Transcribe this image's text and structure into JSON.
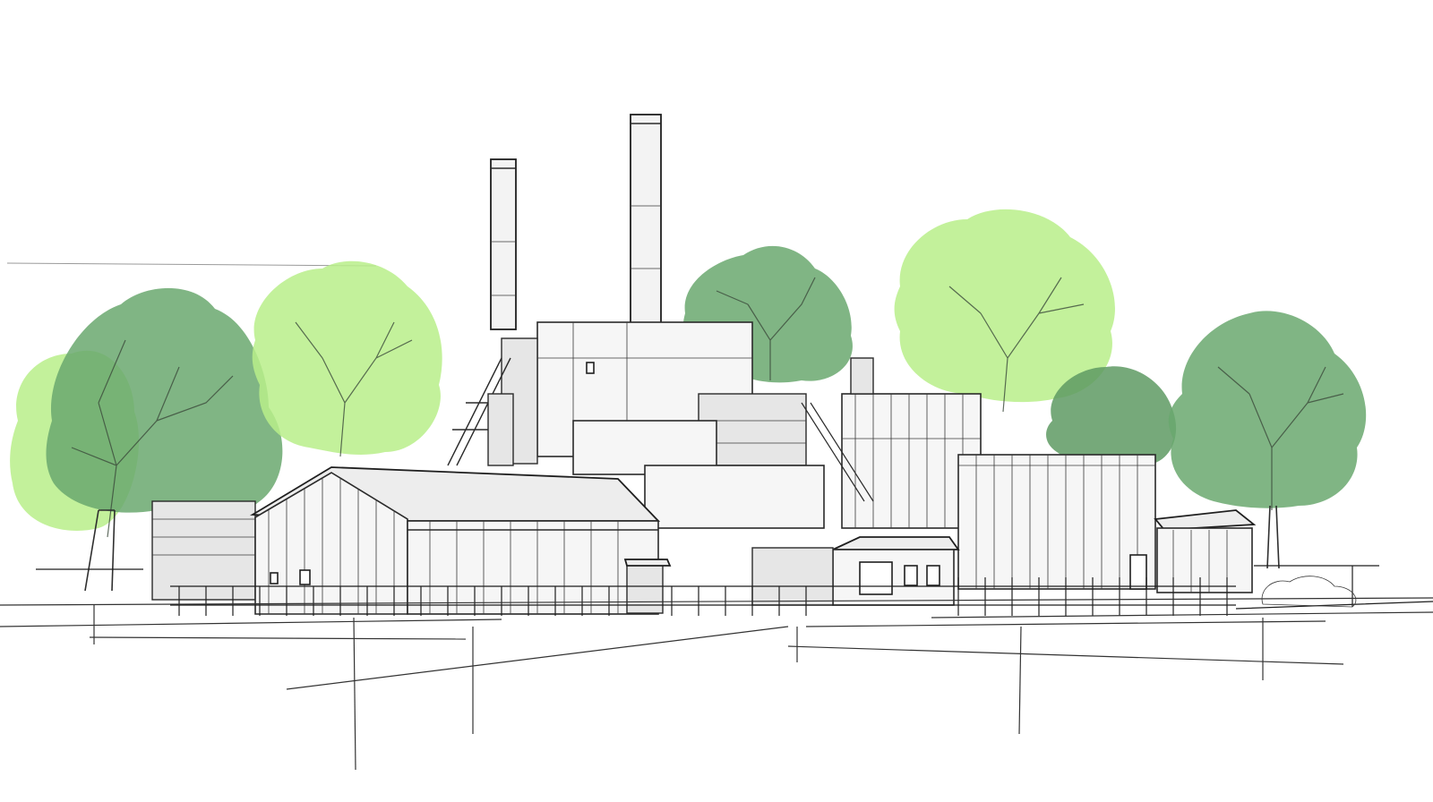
{
  "scene": {
    "kind": "architectural-sketch",
    "subject": "industrial-plant-with-trees",
    "colors": {
      "paper": "#ffffff",
      "ink": "#2a2a2a",
      "tree_dark": "#6aa86f",
      "tree_light": "#b9ef8a"
    },
    "elements": {
      "chimneys": 2,
      "trees": 7,
      "buildings": 6
    }
  }
}
